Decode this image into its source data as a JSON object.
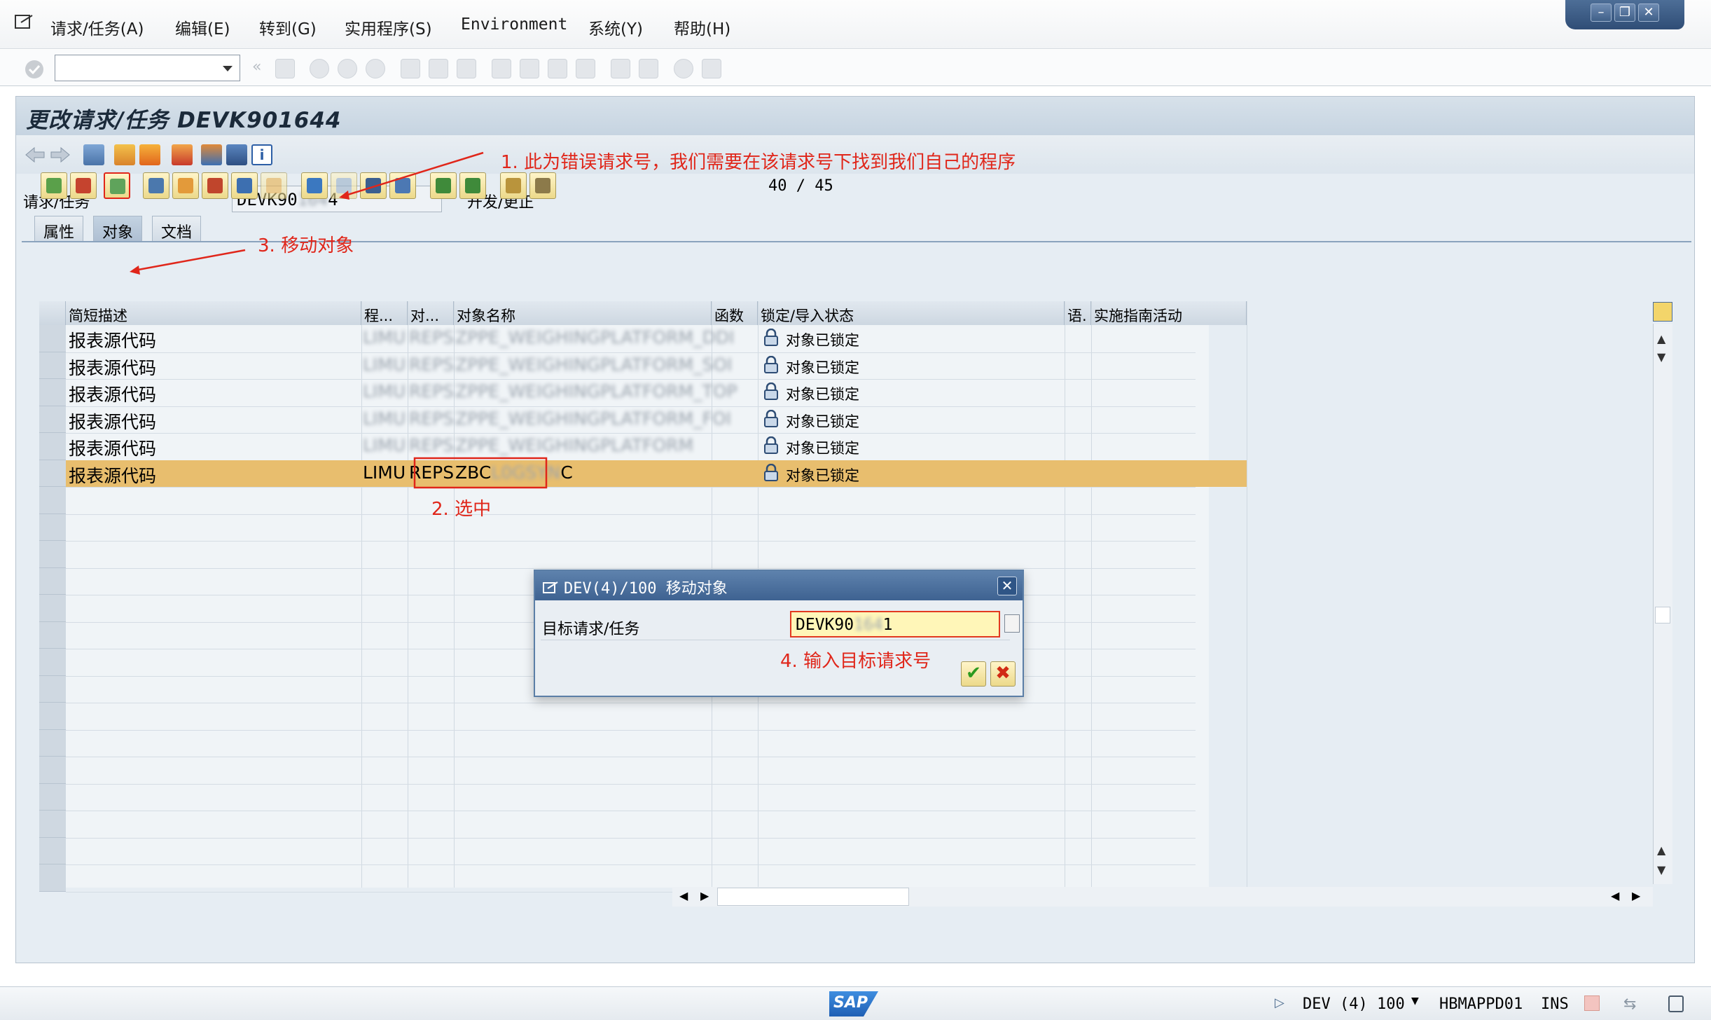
{
  "menu": [
    "请求/任务(A)",
    "编辑(E)",
    "转到(G)",
    "实用程序(S)",
    "Environment",
    "系统(Y)",
    "帮助(H)"
  ],
  "window_controls": {
    "minimize": "–",
    "restore": "❐",
    "close": "✕"
  },
  "title": "更改请求/任务 DEVK901644",
  "request": {
    "label": "请求/任务",
    "value_prefix": "DEVK90",
    "value_hidden": "164",
    "value_suffix": "4",
    "description": "开发/更正"
  },
  "tabs": [
    "属性",
    "对象",
    "文档"
  ],
  "counter": "40 / 45",
  "grid": {
    "columns": [
      "简短描述",
      "程...",
      "对...",
      "对象名称",
      "函数",
      "锁定/导入状态",
      "语.",
      "实施指南活动"
    ],
    "rows": [
      {
        "desc": "报表源代码",
        "pgm": "LIMU",
        "obj": "REPS",
        "name": "ZPPE_WEIGHINGPLATFORM_DDI",
        "lock": "对象已锁定",
        "blurred": true
      },
      {
        "desc": "报表源代码",
        "pgm": "LIMU",
        "obj": "REPS",
        "name": "ZPPE_WEIGHINGPLATFORM_SOI",
        "lock": "对象已锁定",
        "blurred": true
      },
      {
        "desc": "报表源代码",
        "pgm": "LIMU",
        "obj": "REPS",
        "name": "ZPPE_WEIGHINGPLATFORM_TOP",
        "lock": "对象已锁定",
        "blurred": true
      },
      {
        "desc": "报表源代码",
        "pgm": "LIMU",
        "obj": "REPS",
        "name": "ZPPE_WEIGHINGPLATFORM_FOI",
        "lock": "对象已锁定",
        "blurred": true
      },
      {
        "desc": "报表源代码",
        "pgm": "LIMU",
        "obj": "REPS",
        "name": "ZPPE_WEIGHINGPLATFORM",
        "lock": "对象已锁定",
        "blurred": true
      },
      {
        "desc": "报表源代码",
        "pgm": "LIMU",
        "obj": "REPS",
        "name_prefix": "ZBC",
        "name_hidden": "L0GSYN",
        "name_suffix": "C",
        "lock": "对象已锁定",
        "selected": true
      }
    ]
  },
  "dialog": {
    "title": "DEV(4)/100 移动对象",
    "label": "目标请求/任务",
    "value_prefix": "DEVK90",
    "value_hidden": "164",
    "value_suffix": "1",
    "ok": "✔",
    "cancel": "✖"
  },
  "annotations": {
    "a1": "1. 此为错误请求号，我们需要在该请求号下找到我们自己的程序",
    "a2": "2. 选中",
    "a3": "3. 移动对象",
    "a4": "4. 输入目标请求号"
  },
  "status": {
    "system": "DEV (4) 100",
    "server": "HBMAPPD01",
    "mode": "INS",
    "logo": "SAP"
  },
  "colors": {
    "selected_row": "#e8be6e",
    "annotation": "#e0261a",
    "dialog_title": "#3e6291"
  }
}
